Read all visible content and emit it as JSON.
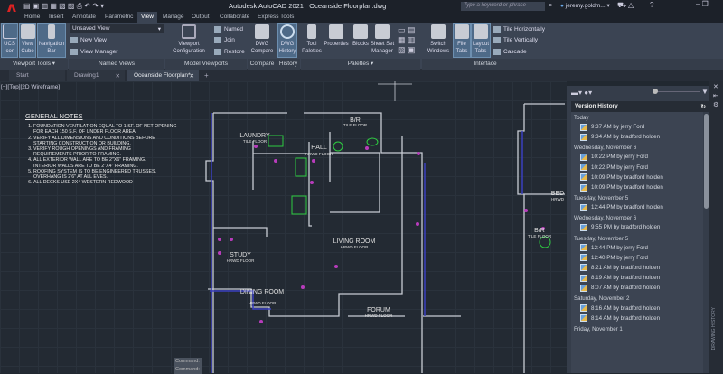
{
  "app": {
    "title": "Autodesk AutoCAD 2021",
    "file": "Oceanside Floorplan.dwg",
    "search_placeholder": "Type a keyword or phrase",
    "user": "jeremy.goldm...",
    "logo": "A"
  },
  "ribbon_tabs": [
    "Home",
    "Insert",
    "Annotate",
    "Parametric",
    "View",
    "Manage",
    "Output",
    "Collaborate",
    "Express Tools"
  ],
  "active_tab": "View",
  "panels": {
    "viewport_tools": {
      "label": "Viewport Tools",
      "buttons": [
        "UCS Icon",
        "View Cube",
        "Navigation Bar"
      ]
    },
    "named_views": {
      "label": "Named Views",
      "dropdown": "Unsaved View",
      "items": [
        "New View",
        "View Manager"
      ]
    },
    "model_viewports": {
      "label": "Model Viewports",
      "button": "Viewport Configuration",
      "items": [
        "Named",
        "Join",
        "Restore"
      ]
    },
    "compare": {
      "label": "Compare",
      "button": "DWG Compare"
    },
    "history": {
      "label": "History",
      "button": "DWG History"
    },
    "palettes": {
      "label": "Palettes",
      "buttons": [
        "Tool Palettes",
        "Properties",
        "Blocks",
        "Sheet Set Manager"
      ]
    },
    "interface": {
      "label": "Interface",
      "buttons": [
        "Switch Windows",
        "File Tabs",
        "Layout Tabs"
      ],
      "items": [
        "Tile Horizontally",
        "Tile Vertically",
        "Cascade"
      ]
    }
  },
  "file_tabs": [
    {
      "label": "Start"
    },
    {
      "label": "Drawing1"
    },
    {
      "label": "Oceanside Floorplan*"
    }
  ],
  "viewport_label": "[−][Top][2D Wireframe]",
  "notes": {
    "title": "GENERAL NOTES",
    "items": [
      "FOUNDATION VENTILATION EQUAL TO 1 SF. OF NET OPENING FOR EACH 150 S.F. OF UNDER FLOOR AREA.",
      "VERIFY ALL DIMENSIONS AND CONDITIONS BEFORE STARTING CONSTRUCTION OR BUILDING.",
      "VERIFY ROUGH OPENINGS AND FRAMING REQUIREMENTS PRIOR TO FRAMING.",
      "ALL EXTERIOR WALL ARE TO BE 2\"X6\" FRAMING. INTERIOR WALLS ARE TO BE 2\"X4\" FRAMING.",
      "ROOFING SYSTEM IS TO BE ENGINEERED TRUSSES. OVERHANG IS 2'6\" AT ALL EVES.",
      "ALL DECKS USE 2X4 WESTERN REDWOOD"
    ]
  },
  "rooms": [
    {
      "name": "LAUNDRY",
      "floor": "TILE FLOOR"
    },
    {
      "name": "B/R",
      "floor": "TILE FLOOR"
    },
    {
      "name": "HALL",
      "floor": "HRWD FLOOR"
    },
    {
      "name": "LIVING ROOM",
      "floor": "HRWD FLOOR"
    },
    {
      "name": "STUDY",
      "floor": "HRWD FLOOR"
    },
    {
      "name": "DINING ROOM",
      "floor": "HRWD FLOOR"
    },
    {
      "name": "FORUM",
      "floor": "HRWD FLOOR"
    },
    {
      "name": "BED",
      "floor": "HRWD"
    },
    {
      "name": "B/R",
      "floor": "TILE FLOOR"
    }
  ],
  "command_lines": [
    "Command:",
    "Command:"
  ],
  "version_history": {
    "title": "Version History",
    "groups": [
      {
        "date": "Today",
        "versions": [
          "9:37 AM by jerry Ford",
          "9:34 AM by bradford holden"
        ]
      },
      {
        "date": "Wednesday, November 6",
        "versions": [
          "10:22 PM by jerry Ford",
          "10:22 PM by jerry Ford",
          "10:09 PM by bradford holden",
          "10:09 PM by bradford holden"
        ]
      },
      {
        "date": "Tuesday, November 5",
        "versions": [
          "12:44 PM by bradford holden"
        ]
      },
      {
        "date": "Wednesday, November 6",
        "versions": [
          "9:55 PM by bradford holden"
        ]
      },
      {
        "date": "Tuesday, November 5",
        "versions": [
          "12:44 PM by jerry Ford",
          "12:40 PM by jerry Ford",
          "8:21 AM by bradford holden",
          "8:19 AM by bradford holden",
          "8:07 AM by bradford holden"
        ]
      },
      {
        "date": "Saturday, November 2",
        "versions": [
          "8:16 AM by bradford holden",
          "8:14 AM by bradford holden"
        ]
      },
      {
        "date": "Friday, November 1",
        "versions": []
      }
    ]
  },
  "side_strip_label": "DRAWING HISTORY",
  "colors": {
    "accent": "#4e6a88",
    "logo": "#dd2222",
    "walls": "#c8ccd4",
    "dims": "#3a3fc0",
    "fixtures": "#2ecc40",
    "outlets": "#b83cbc"
  }
}
